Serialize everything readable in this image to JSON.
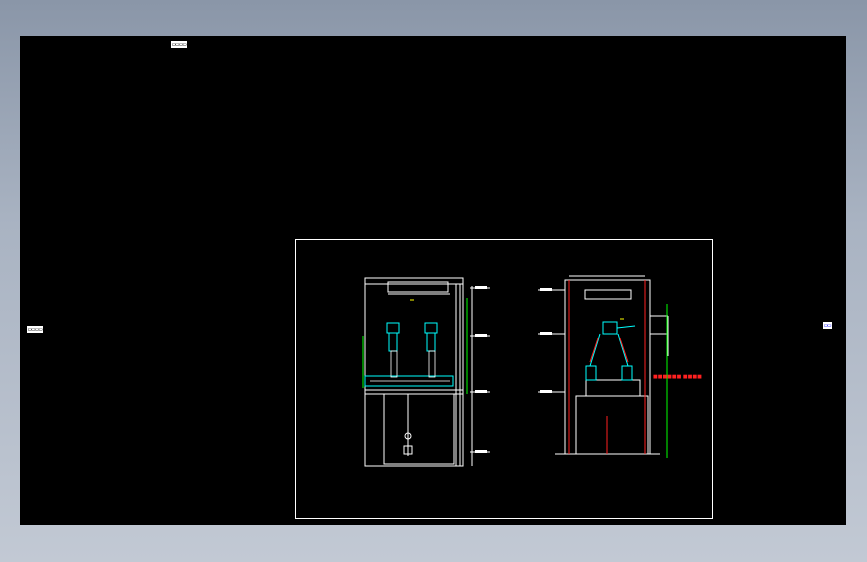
{
  "labels": {
    "top_left": "▭▭▭▭",
    "left": "▭▭▭▭",
    "right": "▭▭"
  },
  "drawing": {
    "annotation_red": "■■■■■■ ■■■■",
    "colors": {
      "background": "#000000",
      "line_white": "#ffffff",
      "line_cyan": "#00ffff",
      "line_green": "#00ff00",
      "line_red": "#ff2020",
      "line_yellow": "#ffff00"
    }
  }
}
